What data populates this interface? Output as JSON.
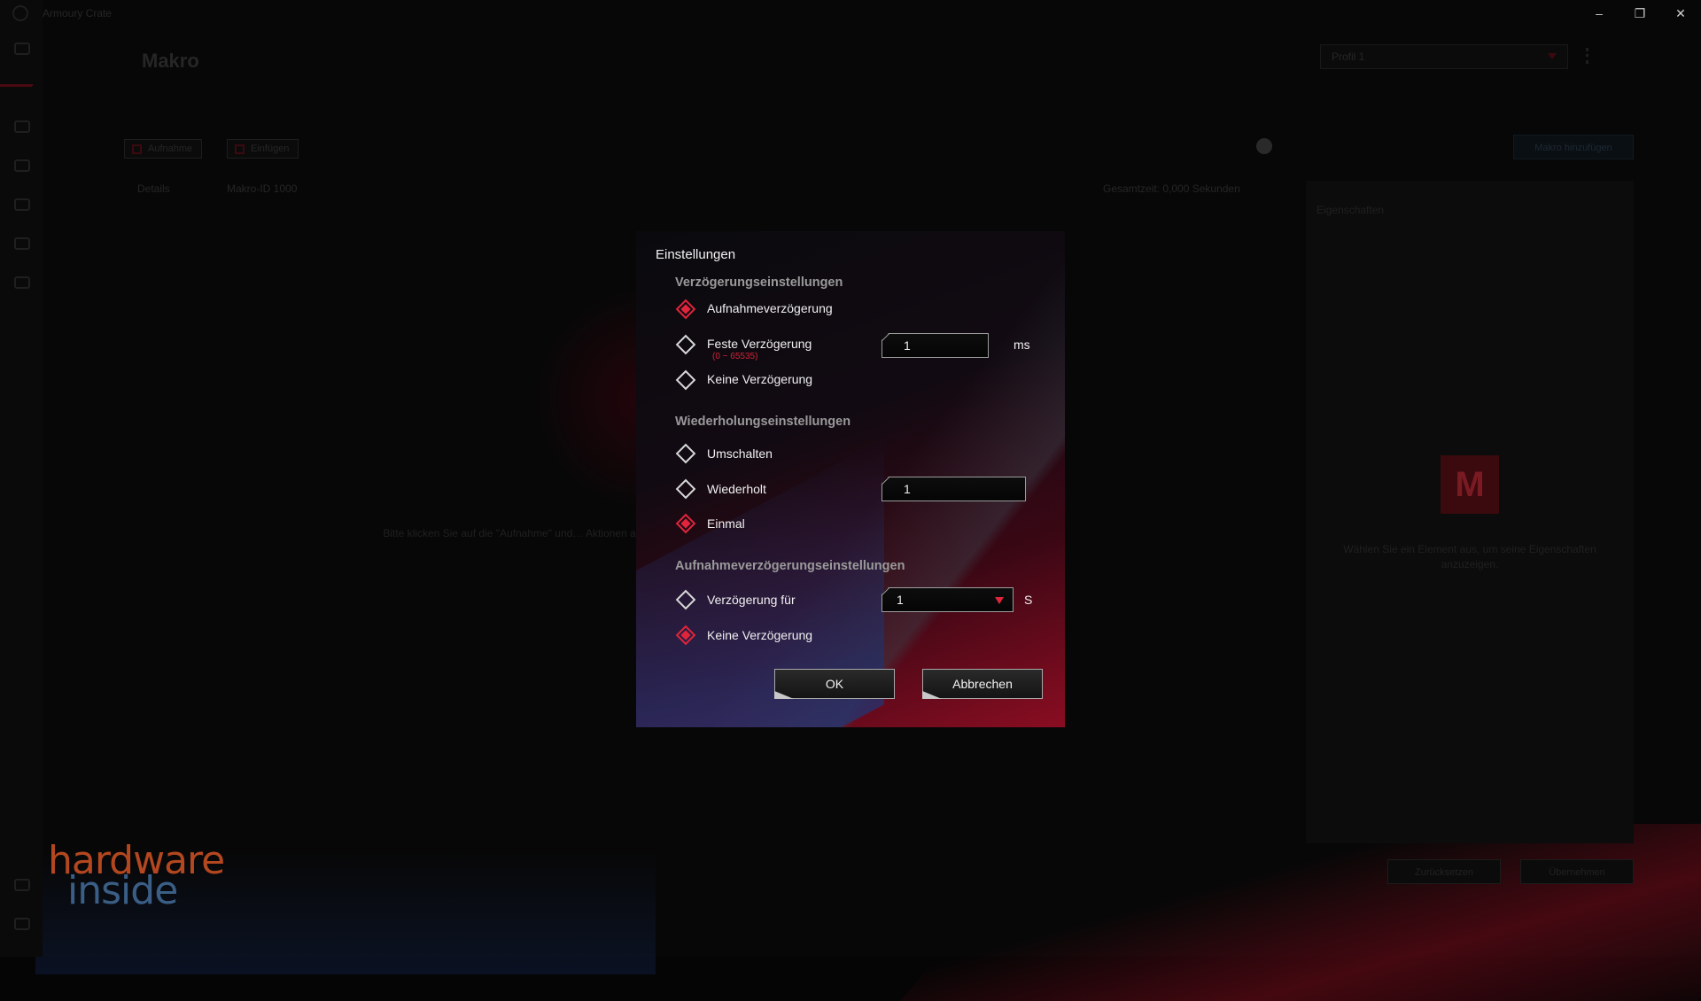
{
  "app": {
    "window_title": "Armoury Crate",
    "page_title": "Makro",
    "profile": "Profil 1"
  },
  "toolbar": {
    "record_label": "Aufnahme",
    "add_label": "Einfügen",
    "add_macro_label": "Makro hinzufügen"
  },
  "columns": {
    "type": "Details",
    "name": "Makro-ID 1000",
    "total": "Gesamtzeit: 0,000 Sekunden"
  },
  "main_hint": "Bitte klicken Sie auf die \"Aufnahme\" und… Aktionen an.",
  "right_panel": {
    "title": "Eigenschaften",
    "badge": "M",
    "hint": "Wählen Sie ein Element aus, um seine Eigenschaften anzuzeigen."
  },
  "bottom_buttons": {
    "reset": "Zurücksetzen",
    "apply": "Übernehmen"
  },
  "dialog": {
    "title": "Einstellungen",
    "delay_section": "Verzögerungseinstellungen",
    "delay_options": {
      "recorded": "Aufnahmeverzögerung",
      "fixed": "Feste Verzögerung",
      "fixed_range": "(0 ~ 65535)",
      "fixed_value": "1",
      "fixed_unit": "ms",
      "none": "Keine Verzögerung"
    },
    "repeat_section": "Wiederholungseinstellungen",
    "repeat_options": {
      "toggle": "Umschalten",
      "repeat": "Wiederholt",
      "repeat_value": "1",
      "once": "Einmal"
    },
    "record_delay_section": "Aufnahmeverzögerungseinstellungen",
    "record_delay_options": {
      "delay_for": "Verzögerung für",
      "delay_for_value": "1",
      "delay_for_unit": "S",
      "none": "Keine Verzögerung"
    },
    "ok_label": "OK",
    "cancel_label": "Abbrechen"
  },
  "watermark": {
    "line1": "hardware",
    "line2": "inside"
  },
  "colors": {
    "accent": "#e0243c",
    "watermark_orange": "#b3471f",
    "watermark_blue": "#3a5e86"
  }
}
